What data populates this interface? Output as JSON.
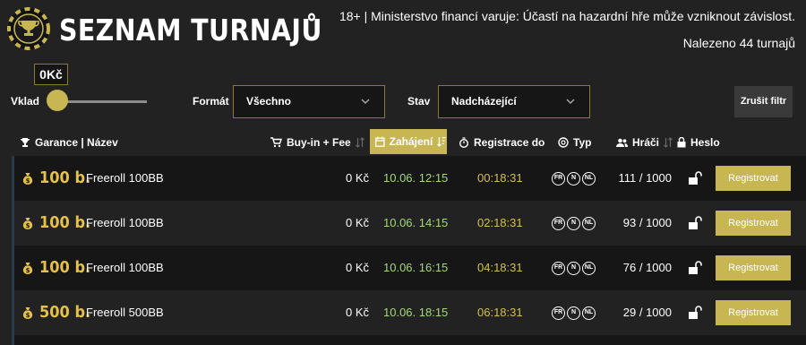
{
  "header": {
    "title": "SEZNAM TURNAJŮ",
    "disclaimer": "18+ | Ministerstvo financí varuje: Účastí na hazardní hře může vzniknout závislost.",
    "count": "Nalezeno 44 turnajů"
  },
  "filters": {
    "deposit_label": "Vklad",
    "deposit_value": "0Kč",
    "deposit_slider_level": 0,
    "format_label": "Formát",
    "format_value": "Všechno",
    "state_label": "Stav",
    "state_value": "Nadcházející",
    "reset_label": "Zrušit filtr"
  },
  "columns": {
    "guarantee": "Garance | Název",
    "buyin": "Buy-in + Fee",
    "start": "Zahájení",
    "registration": "Registrace do",
    "type": "Typ",
    "players": "Hráči",
    "password": "Heslo"
  },
  "rows": [
    {
      "guarantee": "100 b.",
      "name": "Freeroll 100BB",
      "buyin": "0 Kč",
      "start": "10.06. 12:15",
      "reg": "00:18:31",
      "types": [
        "FR",
        "N",
        "NL"
      ],
      "players": "111 / 1000",
      "register": "Registrovat"
    },
    {
      "guarantee": "100 b.",
      "name": "Freeroll 100BB",
      "buyin": "0 Kč",
      "start": "10.06. 14:15",
      "reg": "02:18:31",
      "types": [
        "FR",
        "N",
        "NL"
      ],
      "players": "93 / 1000",
      "register": "Registrovat"
    },
    {
      "guarantee": "100 b.",
      "name": "Freeroll 100BB",
      "buyin": "0 Kč",
      "start": "10.06. 16:15",
      "reg": "04:18:31",
      "types": [
        "FR",
        "N",
        "NL"
      ],
      "players": "76 / 1000",
      "register": "Registrovat"
    },
    {
      "guarantee": "500 b.",
      "name": "Freeroll 500BB",
      "buyin": "0 Kč",
      "start": "10.06. 18:15",
      "reg": "06:18:31",
      "types": [
        "FR",
        "N",
        "NL"
      ],
      "players": "29 / 1000",
      "register": "Registrovat"
    }
  ],
  "colors": {
    "accent": "#c8b653",
    "guarantee": "#e5c04a",
    "start_time": "#a3d977",
    "reg_time": "#d4bf53",
    "background": "#222222",
    "row_dark": "#161616"
  },
  "icons": [
    "poker-chip-trophy-logo",
    "trophy-icon",
    "cart-icon",
    "calendar-icon",
    "stopwatch-icon",
    "chip-icon",
    "users-icon",
    "lock-icon",
    "sort-icon",
    "money-bag-icon",
    "unlock-icon",
    "chevron-down-icon"
  ]
}
